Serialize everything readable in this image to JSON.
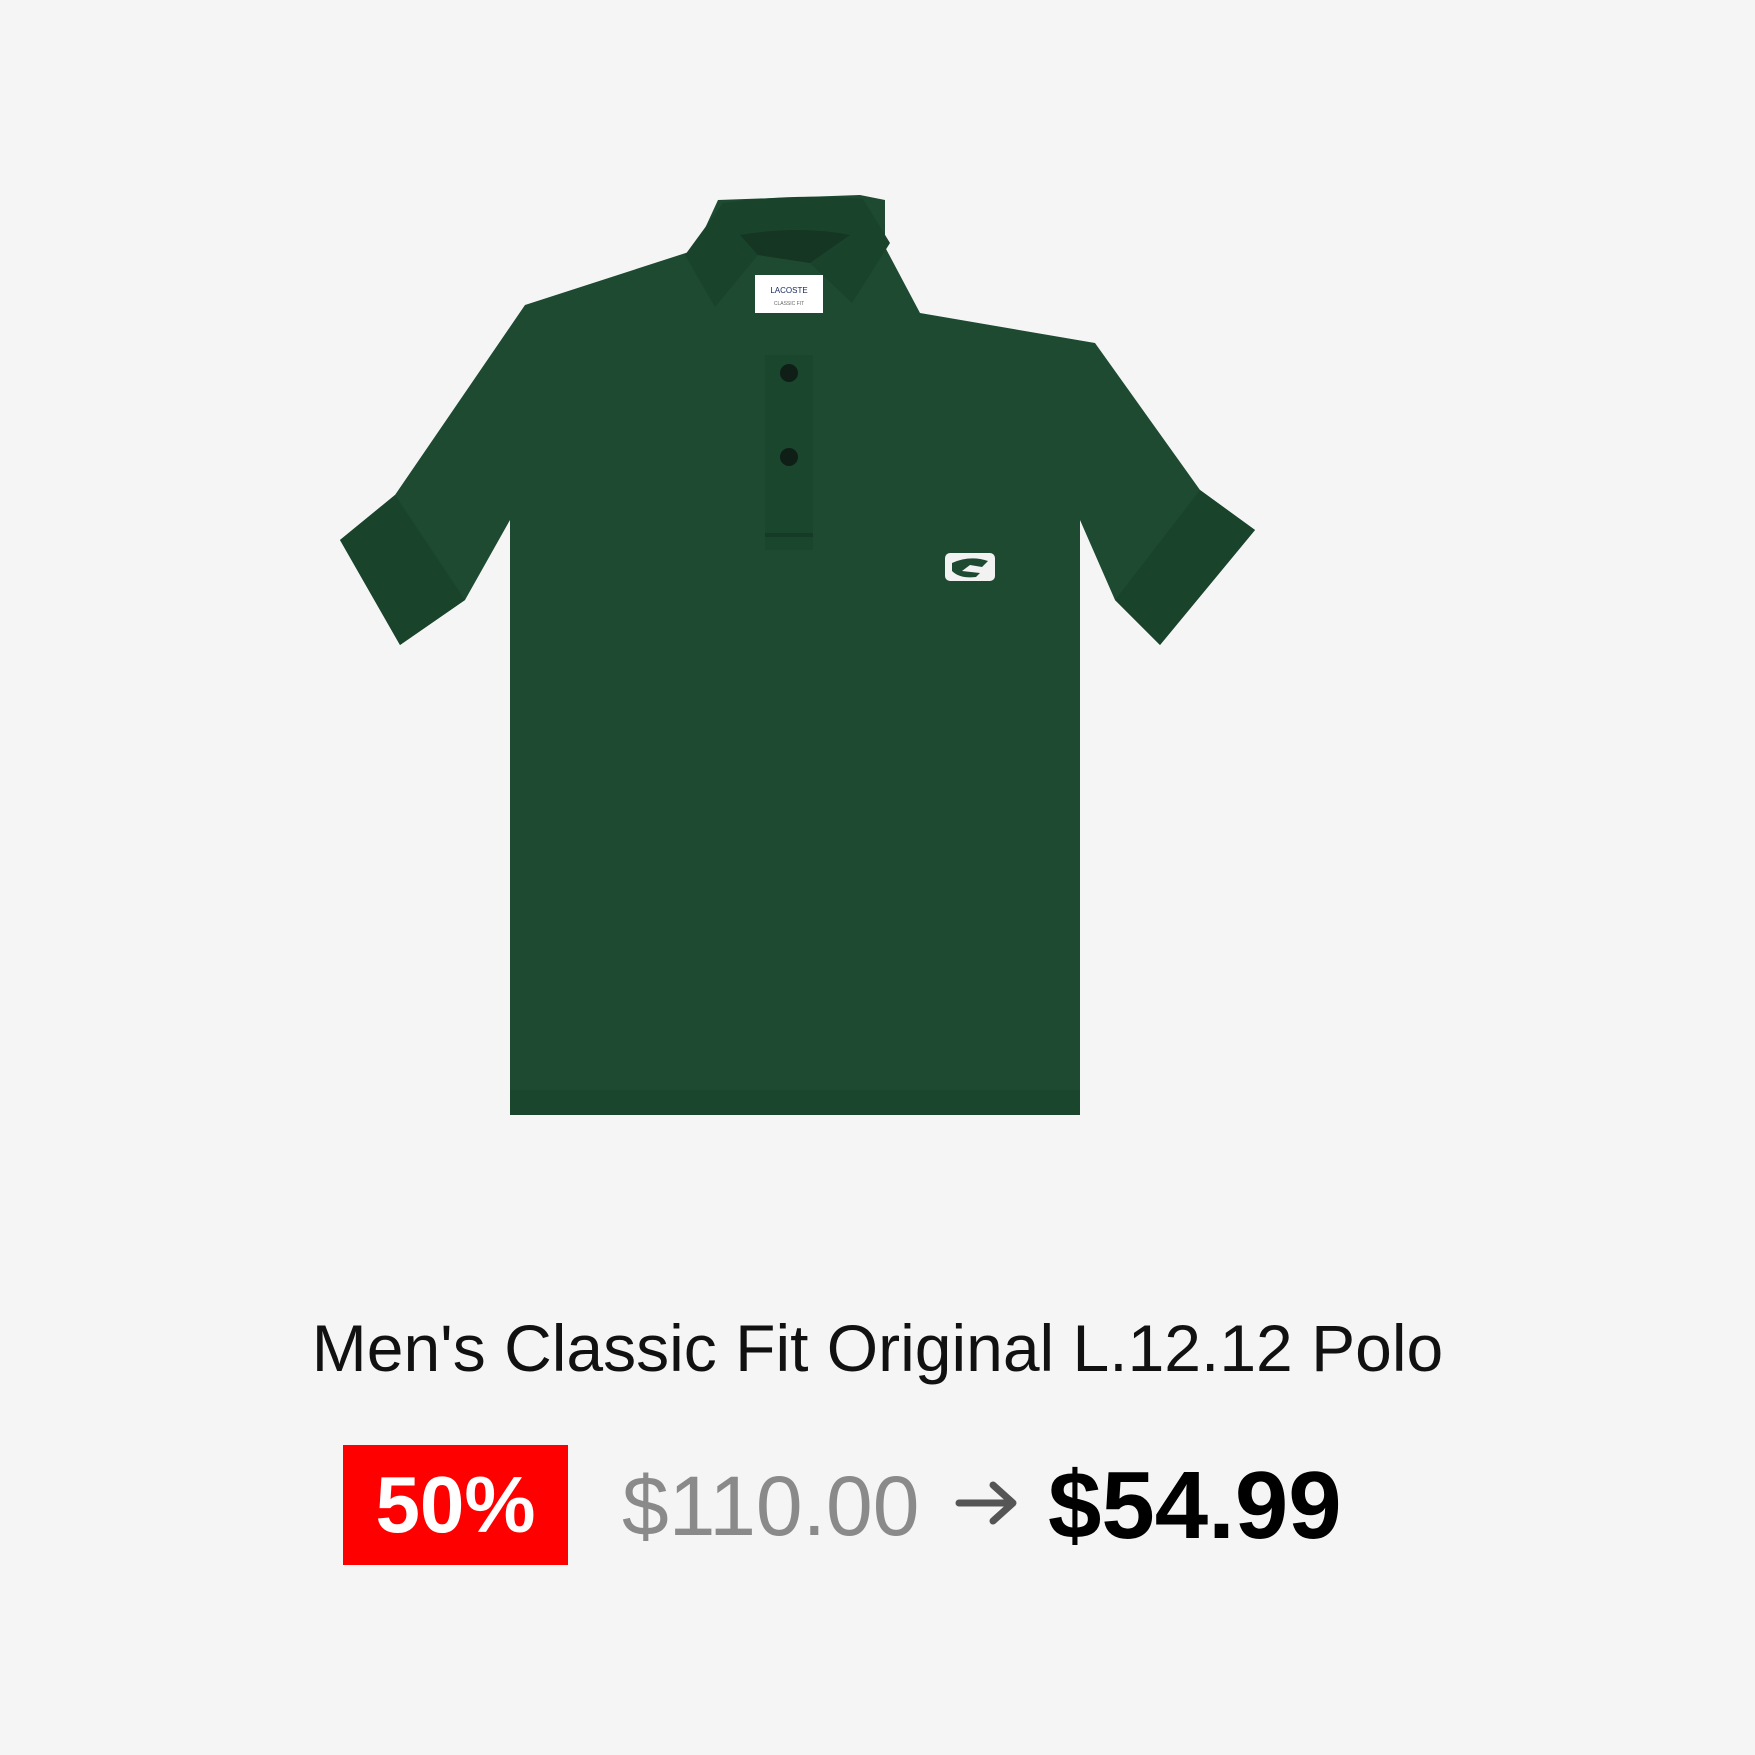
{
  "product": {
    "title": "Men's Classic Fit Original L.12.12 Polo",
    "image_icon": "green-polo-shirt-image",
    "shirt_color": "#1d4a31",
    "label_brand": "LACOSTE",
    "label_fit": "CLASSIC FIT"
  },
  "pricing": {
    "discount": "50%",
    "original_price": "$110.00",
    "arrow_icon": "right-arrow-icon",
    "sale_price": "$54.99"
  },
  "colors": {
    "background": "#f5f5f5",
    "badge": "#ff0000",
    "original_price": "#8a8a8a",
    "sale_price": "#000000"
  }
}
